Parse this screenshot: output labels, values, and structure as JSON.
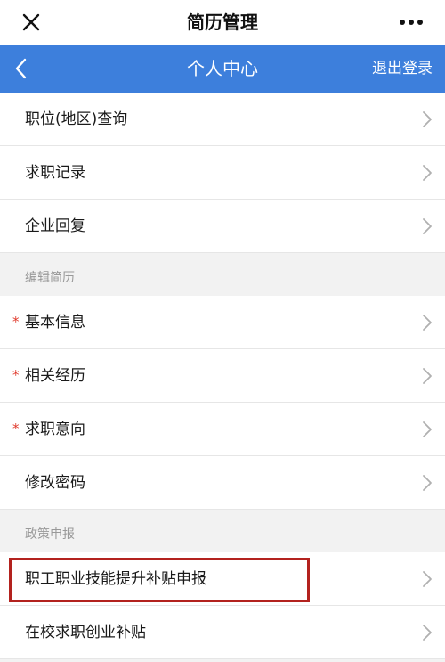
{
  "header": {
    "title": "简历管理",
    "close_icon": "close-icon",
    "more_icon": "more-horizontal-icon"
  },
  "navbar": {
    "title": "个人中心",
    "logout_label": "退出登录",
    "back_icon": "chevron-left-icon",
    "color": "#3d7fdc"
  },
  "menu": {
    "items": [
      {
        "label": "职位(地区)查询"
      },
      {
        "label": "求职记录"
      },
      {
        "label": "企业回复"
      }
    ]
  },
  "resume_section": {
    "title": "编辑简历",
    "items": [
      {
        "label": "基本信息",
        "required_mark": "*"
      },
      {
        "label": "相关经历",
        "required_mark": "*"
      },
      {
        "label": "求职意向",
        "required_mark": "*"
      },
      {
        "label": "修改密码"
      }
    ]
  },
  "policy_section": {
    "title": "政策申报",
    "items": [
      {
        "label": "职工职业技能提升补贴申报",
        "highlighted": true
      },
      {
        "label": "在校求职创业补贴"
      }
    ]
  },
  "colors": {
    "accent": "#3d7fdc",
    "required": "#e03b2e",
    "highlight_border": "#b3221e"
  }
}
